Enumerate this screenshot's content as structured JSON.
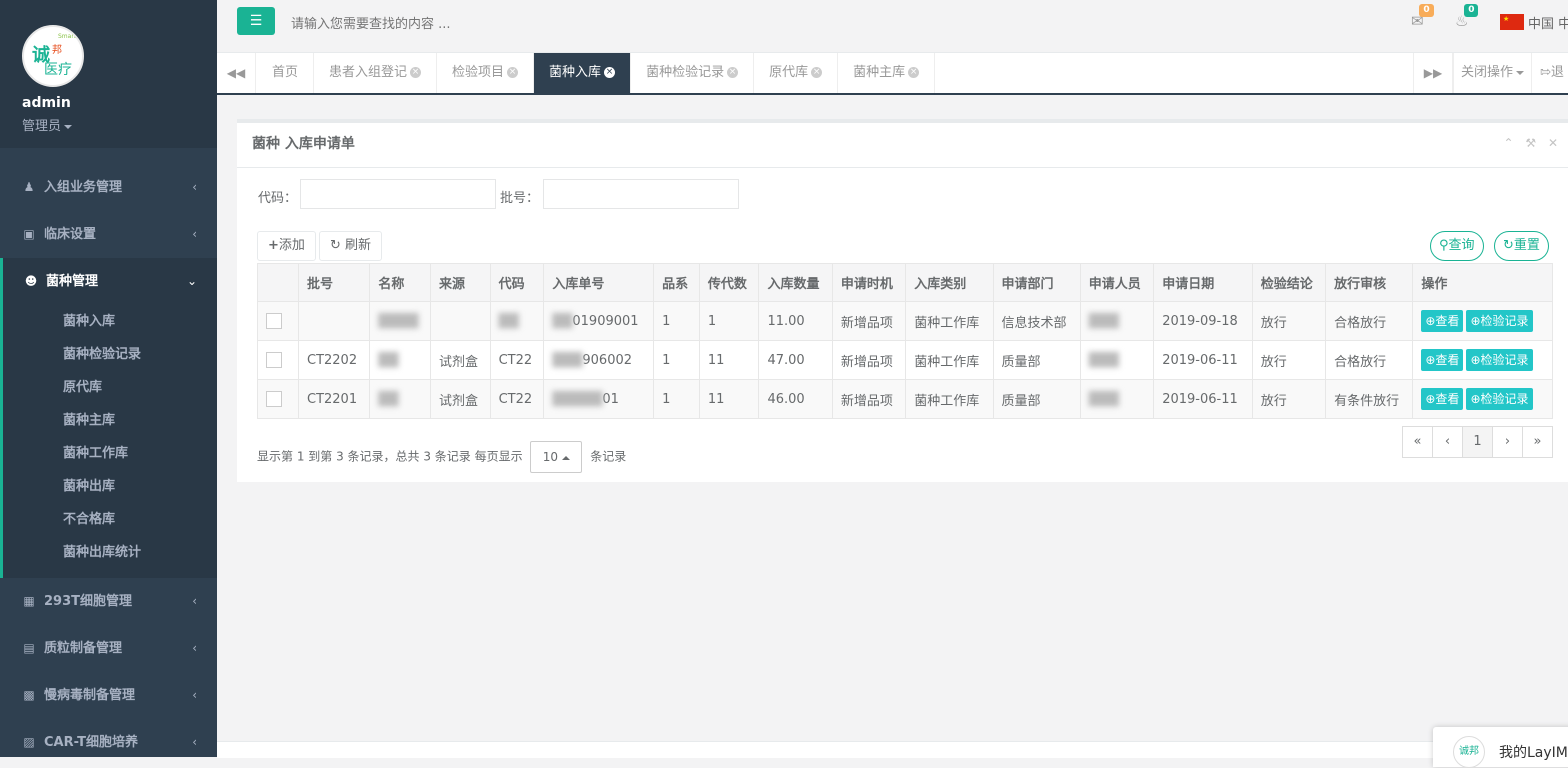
{
  "profile": {
    "logo_text": "诚",
    "logo_sub": "邦",
    "logo_sub2": "医疗",
    "logo_en": "Smart",
    "username": "admin",
    "role": "管理员"
  },
  "sidebar": {
    "items": [
      {
        "label": "入组业务管理",
        "icon": "user-icon"
      },
      {
        "label": "临床设置",
        "icon": "save-icon"
      },
      {
        "label": "菌种管理",
        "icon": "bug-icon"
      },
      {
        "label": "293T细胞管理",
        "icon": "calendar-icon"
      },
      {
        "label": "质粒制备管理",
        "icon": "map-icon"
      },
      {
        "label": "慢病毒制备管理",
        "icon": "hospital-icon"
      },
      {
        "label": "CAR-T细胞培养",
        "icon": "medkit-icon"
      }
    ],
    "submenu": [
      "菌种入库",
      "菌种检验记录",
      "原代库",
      "菌种主库",
      "菌种工作库",
      "菌种出库",
      "不合格库",
      "菌种出库统计"
    ]
  },
  "topbar": {
    "search_placeholder": "请输入您需要查找的内容 ...",
    "mail_count": "0",
    "bell_count": "0",
    "lang": "中国 中"
  },
  "tabs": {
    "items": [
      "首页",
      "患者入组登记",
      "检验项目",
      "菌种入库",
      "菌种检验记录",
      "原代库",
      "菌种主库"
    ],
    "active_index": 3,
    "close_ops": "关闭操作",
    "logout": "退"
  },
  "panel": {
    "title": "菌种 入库申请单",
    "code_label": "代码：",
    "batch_label": "批号：",
    "add_btn": "添加",
    "refresh_btn": "刷新",
    "query_btn": "查询",
    "reset_btn": "重置"
  },
  "table": {
    "headers": [
      "批号",
      "名称",
      "来源",
      "代码",
      "入库单号",
      "品系",
      "传代数",
      "入库数量",
      "申请时机",
      "入库类别",
      "申请部门",
      "申请人员",
      "申请日期",
      "检验结论",
      "放行审核",
      "操作"
    ],
    "rows": [
      {
        "batch": "",
        "name": "",
        "source": "",
        "code": "",
        "order": "01909001",
        "strain": "1",
        "passage": "1",
        "qty": "11.00",
        "timing": "新增品项",
        "category": "菌种工作库",
        "dept": "信息技术部",
        "person": "",
        "date": "2019-09-18",
        "conclusion": "放行",
        "review": "合格放行"
      },
      {
        "batch": "CT2202",
        "name": "",
        "source": "试剂盒",
        "code": "CT22",
        "order": "906002",
        "strain": "1",
        "passage": "11",
        "qty": "47.00",
        "timing": "新增品项",
        "category": "菌种工作库",
        "dept": "质量部",
        "person": "",
        "date": "2019-06-11",
        "conclusion": "放行",
        "review": "合格放行"
      },
      {
        "batch": "CT2201",
        "name": "",
        "source": "试剂盒",
        "code": "CT22",
        "order": "01",
        "strain": "1",
        "passage": "11",
        "qty": "46.00",
        "timing": "新增品项",
        "category": "菌种工作库",
        "dept": "质量部",
        "person": "",
        "date": "2019-06-11",
        "conclusion": "放行",
        "review": "有条件放行"
      }
    ],
    "view_btn": "查看",
    "record_btn": "检验记录"
  },
  "pagination": {
    "info_prefix": "显示第 1 到第 3 条记录，总共 3 条记录 每页显示",
    "page_size": "10",
    "info_suffix": "条记录",
    "first": "«",
    "prev": "‹",
    "current": "1",
    "next": "›",
    "last": "»"
  },
  "chat": {
    "label": "我的LayIM",
    "logo_text": "诚邦"
  },
  "colors": {
    "sidebar": "#2f4050",
    "accent": "#1ab394",
    "info": "#23c6c8",
    "warning": "#f8ac59"
  }
}
